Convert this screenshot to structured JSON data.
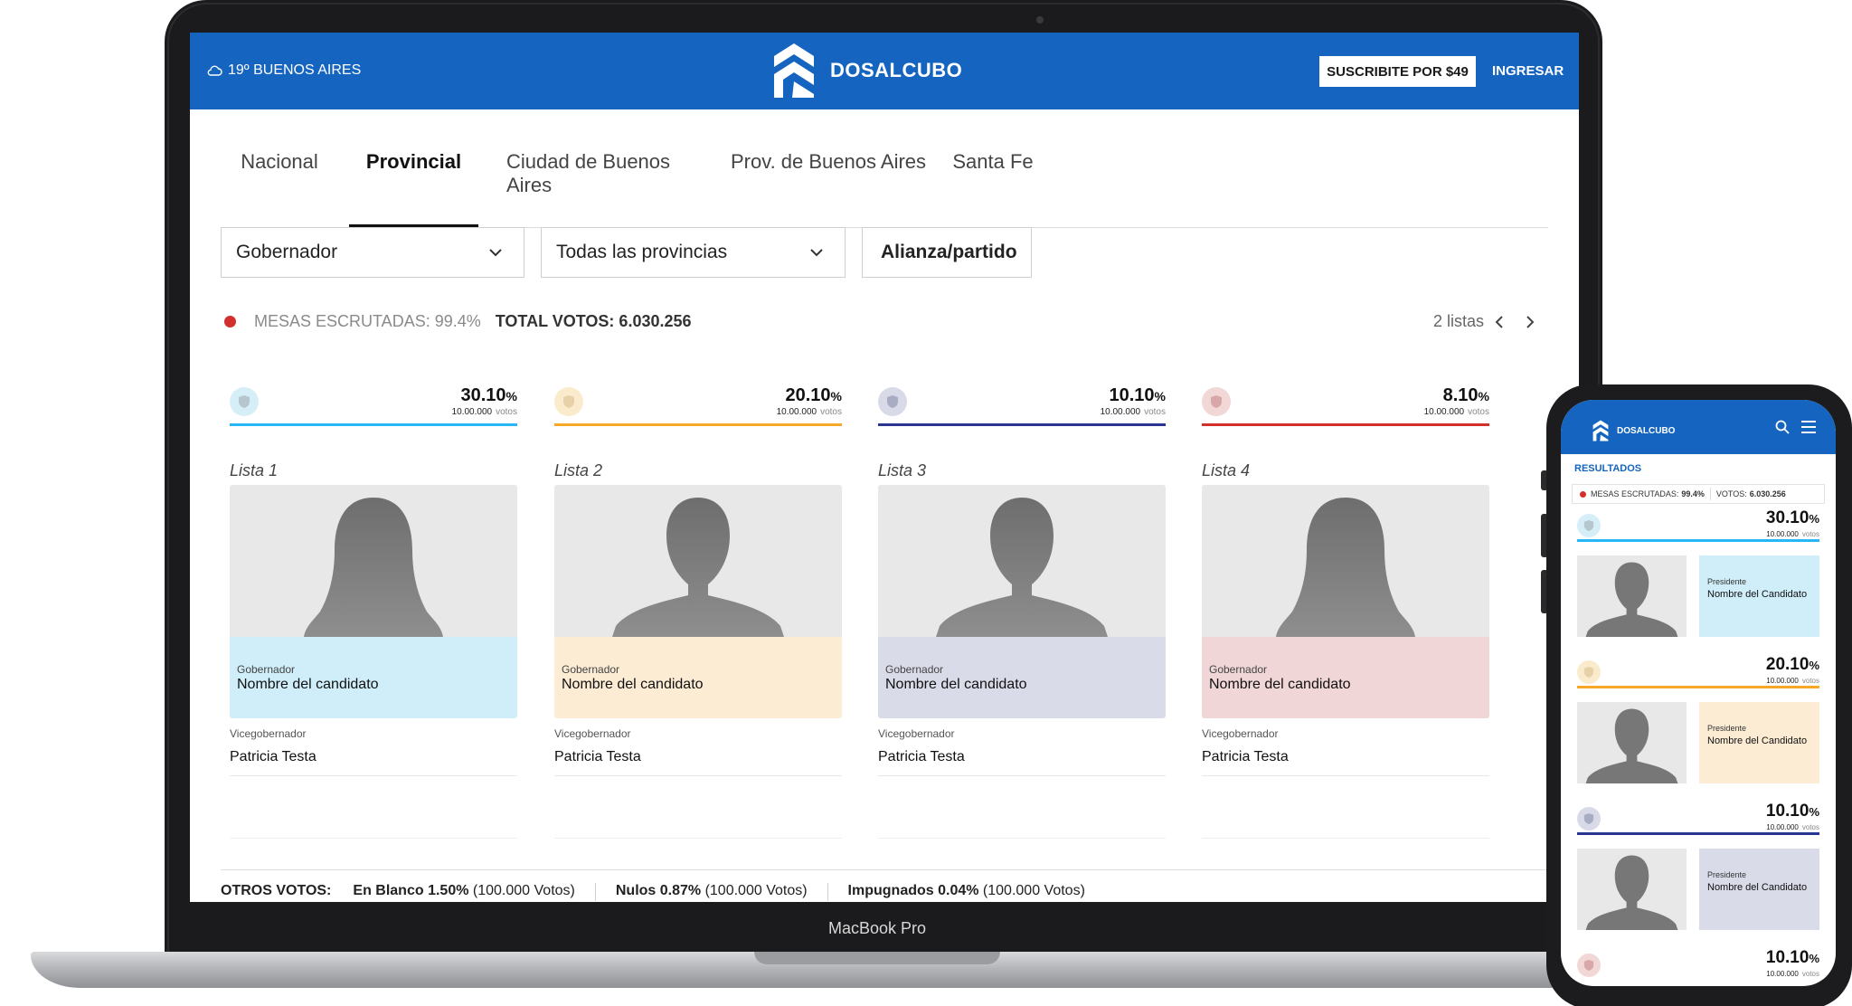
{
  "laptop": {
    "label": "MacBook Pro",
    "header": {
      "weather": "19º BUENOS AIRES",
      "brand": "DOSALCUBO",
      "subscribe": "SUSCRIBITE POR $49",
      "login": "INGRESAR",
      "color": "#1565c0"
    },
    "tabs": [
      "Nacional",
      "Provincial",
      "Ciudad de Buenos Aires",
      "Prov. de Buenos Aires",
      "Santa Fe"
    ],
    "active_tab": "Provincial",
    "filters": {
      "cargo": "Gobernador",
      "provincia": "Todas las provincias",
      "alianza": "Alianza/partido"
    },
    "stats": {
      "mesas": "MESAS ESCRUTADAS: 99.4%",
      "total": "TOTAL VOTOS: 6.030.256",
      "listas": "2 listas"
    },
    "results": [
      {
        "pct": "30.10",
        "unit": "%",
        "votes": "10.00.000",
        "votes_label": "votos",
        "list": "Lista 1",
        "role": "Gobernador",
        "candidate": "Nombre del candidato",
        "vice_role": "Vicegobernador",
        "vice": "Patricia Testa",
        "color": "#29b6f6",
        "tint": "#cfeef9",
        "shield_bg": "#d6eef8",
        "gender": "f",
        "share": 0.301
      },
      {
        "pct": "20.10",
        "unit": "%",
        "votes": "10.00.000",
        "votes_label": "votos",
        "list": "Lista 2",
        "role": "Gobernador",
        "candidate": "Nombre del candidato",
        "vice_role": "Vicegobernador",
        "vice": "Patricia Testa",
        "color": "#f7a826",
        "tint": "#fcecd4",
        "shield_bg": "#fbebcd",
        "gender": "m",
        "share": 0.201
      },
      {
        "pct": "10.10",
        "unit": "%",
        "votes": "10.00.000",
        "votes_label": "votos",
        "list": "Lista 3",
        "role": "Gobernador",
        "candidate": "Nombre del candidato",
        "vice_role": "Vicegobernador",
        "vice": "Patricia Testa",
        "color": "#283593",
        "tint": "#d9dbe9",
        "shield_bg": "#d8dae8",
        "gender": "m",
        "share": 0.101
      },
      {
        "pct": "8.10",
        "unit": "%",
        "votes": "10.00.000",
        "votes_label": "votos",
        "list": "Lista 4",
        "role": "Gobernador",
        "candidate": "Nombre del candidato",
        "vice_role": "Vicegobernador",
        "vice": "Patricia Testa",
        "color": "#d32f2f",
        "tint": "#f0d6d6",
        "shield_bg": "#f2d7d7",
        "gender": "f",
        "share": 0.081
      }
    ],
    "otros": {
      "label": "OTROS VOTOS:",
      "blanco_b": "En Blanco 1.50%",
      "blanco_v": "(100.000 Votos)",
      "nulos_b": "Nulos 0.87%",
      "nulos_v": "(100.000 Votos)",
      "impug_b": "Impugnados 0.04%",
      "impug_v": "(100.000 Votos)"
    }
  },
  "phone": {
    "brand": "DOSALCUBO",
    "title": "RESULTADOS",
    "mesas_label": "MESAS ESCRUTADAS:",
    "mesas_value": "99.4%",
    "votos_label": "VOTOS:",
    "votos_value": "6.030.256",
    "results": [
      {
        "pct": "30.10",
        "unit": "%",
        "votes": "10.00.000",
        "votes_label": "votos",
        "role": "Presidente",
        "candidate": "Nombre del Candidato",
        "color": "#29b6f6",
        "tint": "#cfeef9",
        "shield_bg": "#d6eef8"
      },
      {
        "pct": "20.10",
        "unit": "%",
        "votes": "10.00.000",
        "votes_label": "votos",
        "role": "Presidente",
        "candidate": "Nombre del Candidato",
        "color": "#f7a826",
        "tint": "#fcecd4",
        "shield_bg": "#fbebcd"
      },
      {
        "pct": "10.10",
        "unit": "%",
        "votes": "10.00.000",
        "votes_label": "votos",
        "role": "Presidente",
        "candidate": "Nombre del Candidato",
        "color": "#283593",
        "tint": "#d9dbe9",
        "shield_bg": "#d8dae8"
      },
      {
        "pct": "10.10",
        "unit": "%",
        "votes": "10.00.000",
        "votes_label": "votos",
        "color": "#d32f2f",
        "shield_bg": "#f2d7d7"
      }
    ]
  }
}
